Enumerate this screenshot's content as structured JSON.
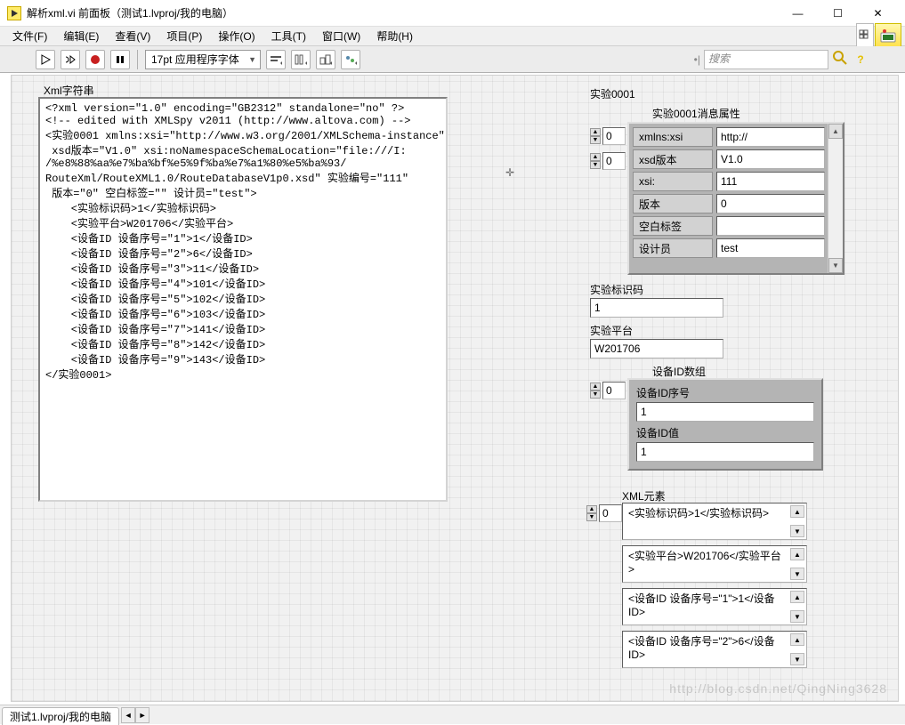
{
  "window": {
    "title": "解析xml.vi 前面板（测试1.lvproj/我的电脑）"
  },
  "menu": {
    "file": "文件(F)",
    "edit": "编辑(E)",
    "view": "查看(V)",
    "project": "项目(P)",
    "operate": "操作(O)",
    "tools": "工具(T)",
    "window": "窗口(W)",
    "help": "帮助(H)"
  },
  "toolbar": {
    "font": "17pt 应用程序字体",
    "search_placeholder": "搜索"
  },
  "left": {
    "label": "Xml字符串",
    "lines": [
      "<?xml version=\"1.0\" encoding=\"GB2312\" standalone=\"no\" ?>",
      "<!-- edited with XMLSpy v2011 (http://www.altova.com) -->",
      "<实验0001 xmlns:xsi=\"http://www.w3.org/2001/XMLSchema-instance\"",
      " xsd版本=\"V1.0\" xsi:noNamespaceSchemaLocation=\"file:///I:",
      "/%e8%88%aa%e7%ba%bf%e5%9f%ba%e7%a1%80%e5%ba%93/",
      "RouteXml/RouteXML1.0/RouteDatabaseV1p0.xsd\" 实验编号=\"111\"",
      " 版本=\"0\" 空白标签=\"\" 设计员=\"test\">",
      "    <实验标识码>1</实验标识码>",
      "    <实验平台>W201706</实验平台>",
      "    <设备ID 设备序号=\"1\">1</设备ID>",
      "    <设备ID 设备序号=\"2\">6</设备ID>",
      "    <设备ID 设备序号=\"3\">11</设备ID>",
      "    <设备ID 设备序号=\"4\">101</设备ID>",
      "    <设备ID 设备序号=\"5\">102</设备ID>",
      "    <设备ID 设备序号=\"6\">103</设备ID>",
      "    <设备ID 设备序号=\"7\">141</设备ID>",
      "    <设备ID 设备序号=\"8\">142</设备ID>",
      "    <设备ID 设备序号=\"9\">143</设备ID>",
      "</实验0001>"
    ]
  },
  "right": {
    "cluster_label": "实验0001",
    "attr_title": "实验0001消息属性",
    "attr_index1": "0",
    "attr_index2": "0",
    "attrs": [
      {
        "k": "xmlns:xsi",
        "v": "http://"
      },
      {
        "k": "xsd版本",
        "v": "V1.0"
      },
      {
        "k": "xsi:",
        "v": "111"
      },
      {
        "k": "版本",
        "v": "0"
      },
      {
        "k": "空白标签",
        "v": ""
      },
      {
        "k": "设计员",
        "v": "test"
      }
    ],
    "id_label": "实验标识码",
    "id_value": "1",
    "platform_label": "实验平台",
    "platform_value": "W201706",
    "dev_array_label": "设备ID数组",
    "dev_index": "0",
    "dev_seq_label": "设备ID序号",
    "dev_seq_value": "1",
    "dev_val_label": "设备ID值",
    "dev_val_value": "1",
    "xml_elem_label": "XML元素",
    "xml_elem_index": "0",
    "xml_elems": [
      "<实验标识码>1</实验标识码>",
      "<实验平台>W201706</实验平台>",
      "<设备ID 设备序号=\"1\">1</设备ID>",
      "<设备ID 设备序号=\"2\">6</设备ID>"
    ]
  },
  "status": {
    "tab": "测试1.lvproj/我的电脑"
  },
  "watermark": "http://blog.csdn.net/QingNing3628"
}
